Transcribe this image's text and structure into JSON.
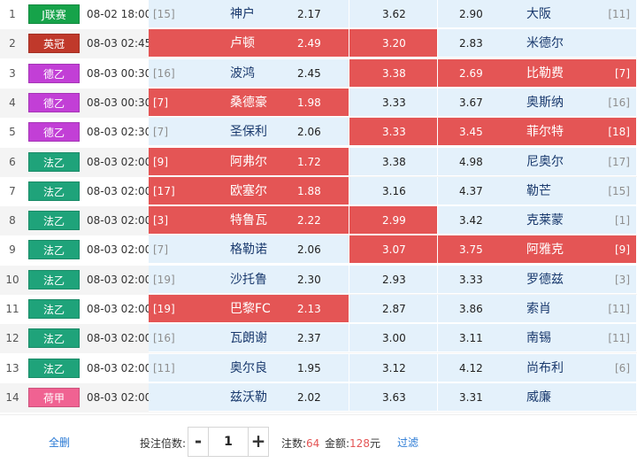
{
  "colors": {
    "row_even_bg": "#f4f4f4",
    "row_odd_bg": "#ffffff",
    "cell_blue": "#e4f1fb",
    "cell_red": "#e45555",
    "link": "#2a7ad5",
    "accent": "#e45555"
  },
  "matches": [
    {
      "no": "1",
      "league": "J联赛",
      "league_color": "#16a34a",
      "time": "08-02 18:00",
      "home_rank": "[15]",
      "home": "神户",
      "home_odds": "2.17",
      "draw_odds": "3.62",
      "away_odds": "2.90",
      "away": "大阪",
      "away_rank": "[11]",
      "sel": [
        false,
        false,
        false
      ]
    },
    {
      "no": "2",
      "league": "英冠",
      "league_color": "#c0392b",
      "time": "08-03 02:45",
      "home_rank": "",
      "home": "卢顿",
      "home_odds": "2.49",
      "draw_odds": "3.20",
      "away_odds": "2.83",
      "away": "米德尔",
      "away_rank": "",
      "sel": [
        true,
        true,
        false
      ]
    },
    {
      "no": "3",
      "league": "德乙",
      "league_color": "#c23fd6",
      "time": "08-03 00:30",
      "home_rank": "[16]",
      "home": "波鸿",
      "home_odds": "2.45",
      "draw_odds": "3.38",
      "away_odds": "2.69",
      "away": "比勒费",
      "away_rank": "[7]",
      "sel": [
        false,
        true,
        true
      ]
    },
    {
      "no": "4",
      "league": "德乙",
      "league_color": "#c23fd6",
      "time": "08-03 00:30",
      "home_rank": "[7]",
      "home": "桑德豪",
      "home_odds": "1.98",
      "draw_odds": "3.33",
      "away_odds": "3.67",
      "away": "奥斯纳",
      "away_rank": "[16]",
      "sel": [
        true,
        false,
        false
      ]
    },
    {
      "no": "5",
      "league": "德乙",
      "league_color": "#c23fd6",
      "time": "08-03 02:30",
      "home_rank": "[7]",
      "home": "圣保利",
      "home_odds": "2.06",
      "draw_odds": "3.33",
      "away_odds": "3.45",
      "away": "菲尔特",
      "away_rank": "[18]",
      "sel": [
        false,
        true,
        true
      ]
    },
    {
      "no": "6",
      "league": "法乙",
      "league_color": "#1fa37a",
      "time": "08-03 02:00",
      "home_rank": "[9]",
      "home": "阿弗尔",
      "home_odds": "1.72",
      "draw_odds": "3.38",
      "away_odds": "4.98",
      "away": "尼奥尔",
      "away_rank": "[17]",
      "sel": [
        true,
        false,
        false
      ]
    },
    {
      "no": "7",
      "league": "法乙",
      "league_color": "#1fa37a",
      "time": "08-03 02:00",
      "home_rank": "[17]",
      "home": "欧塞尔",
      "home_odds": "1.88",
      "draw_odds": "3.16",
      "away_odds": "4.37",
      "away": "勒芒",
      "away_rank": "[15]",
      "sel": [
        true,
        false,
        false
      ]
    },
    {
      "no": "8",
      "league": "法乙",
      "league_color": "#1fa37a",
      "time": "08-03 02:00",
      "home_rank": "[3]",
      "home": "特鲁瓦",
      "home_odds": "2.22",
      "draw_odds": "2.99",
      "away_odds": "3.42",
      "away": "克莱蒙",
      "away_rank": "[1]",
      "sel": [
        true,
        true,
        false
      ]
    },
    {
      "no": "9",
      "league": "法乙",
      "league_color": "#1fa37a",
      "time": "08-03 02:00",
      "home_rank": "[7]",
      "home": "格勒诺",
      "home_odds": "2.06",
      "draw_odds": "3.07",
      "away_odds": "3.75",
      "away": "阿雅克",
      "away_rank": "[9]",
      "sel": [
        false,
        true,
        true
      ]
    },
    {
      "no": "10",
      "league": "法乙",
      "league_color": "#1fa37a",
      "time": "08-03 02:00",
      "home_rank": "[19]",
      "home": "沙托鲁",
      "home_odds": "2.30",
      "draw_odds": "2.93",
      "away_odds": "3.33",
      "away": "罗德兹",
      "away_rank": "[3]",
      "sel": [
        false,
        false,
        false
      ]
    },
    {
      "no": "11",
      "league": "法乙",
      "league_color": "#1fa37a",
      "time": "08-03 02:00",
      "home_rank": "[19]",
      "home": "巴黎FC",
      "home_odds": "2.13",
      "draw_odds": "2.87",
      "away_odds": "3.86",
      "away": "索肖",
      "away_rank": "[11]",
      "sel": [
        true,
        false,
        false
      ]
    },
    {
      "no": "12",
      "league": "法乙",
      "league_color": "#1fa37a",
      "time": "08-03 02:00",
      "home_rank": "[16]",
      "home": "瓦朗谢",
      "home_odds": "2.37",
      "draw_odds": "3.00",
      "away_odds": "3.11",
      "away": "南锡",
      "away_rank": "[11]",
      "sel": [
        false,
        false,
        false
      ]
    },
    {
      "no": "13",
      "league": "法乙",
      "league_color": "#1fa37a",
      "time": "08-03 02:00",
      "home_rank": "[11]",
      "home": "奥尔良",
      "home_odds": "1.95",
      "draw_odds": "3.12",
      "away_odds": "4.12",
      "away": "尚布利",
      "away_rank": "[6]",
      "sel": [
        false,
        false,
        false
      ]
    },
    {
      "no": "14",
      "league": "荷甲",
      "league_color": "#f06292",
      "time": "08-03 02:00",
      "home_rank": "",
      "home": "兹沃勒",
      "home_odds": "2.02",
      "draw_odds": "3.63",
      "away_odds": "3.31",
      "away": "威廉",
      "away_rank": "",
      "sel": [
        false,
        false,
        false
      ]
    }
  ],
  "footer": {
    "clear_all": "全删",
    "multiplier_label": "投注倍数:",
    "minus": "-",
    "multiplier_value": "1",
    "plus": "+",
    "count_label": "注数:",
    "count_value": "64",
    "amount_label": "金额:",
    "amount_value": "128",
    "amount_unit": "元",
    "filter": "过滤"
  }
}
